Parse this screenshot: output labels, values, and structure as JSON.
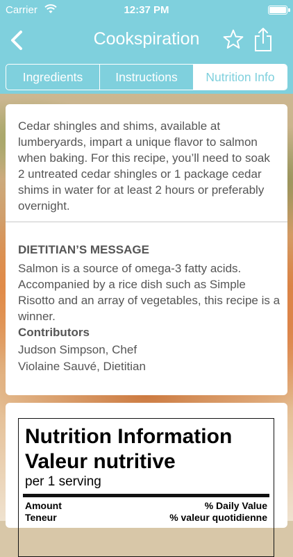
{
  "status": {
    "carrier": "Carrier",
    "time": "12:37 PM"
  },
  "nav": {
    "title": "Cookspiration"
  },
  "tabs": [
    {
      "label": "Ingredients"
    },
    {
      "label": "Instructions"
    },
    {
      "label": "Nutrition Info"
    }
  ],
  "intro": "Cedar shingles and shims, available at lumberyards, impart a unique flavor to salmon when baking. For this recipe, you’ll need to soak 2 untreated cedar shingles or 1 package cedar shims in water for at least 2 hours or preferably overnight.",
  "dietitian": {
    "title": "DIETITIAN’S MESSAGE",
    "body": "Salmon is a source of omega-3 fatty acids. Accompanied by a rice dish such as Simple Risotto and an array of vegetables, this recipe is a winner."
  },
  "contributors": {
    "title": "Contributors",
    "names": [
      "Judson Simpson, Chef",
      "Violaine Sauvé, Dietitian"
    ]
  },
  "nutrition": {
    "title_en": "Nutrition Information",
    "title_fr": "Valeur nutritive",
    "per": "per 1 serving",
    "amount_en": "Amount",
    "amount_fr": "Teneur",
    "dv_en": "% Daily Value",
    "dv_fr": "% valeur quotidienne"
  },
  "colors": {
    "accent": "#7fd0dd"
  }
}
